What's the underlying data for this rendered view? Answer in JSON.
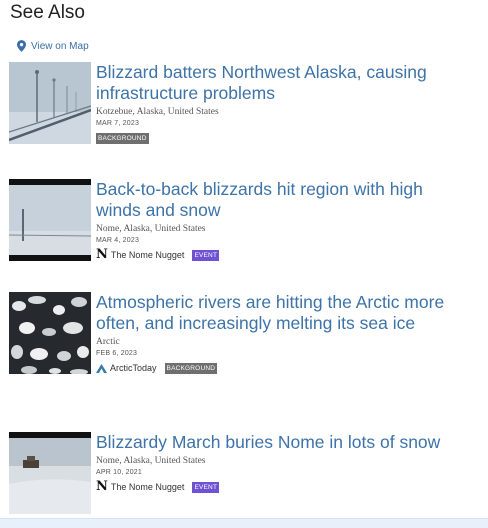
{
  "section": {
    "heading": "See Also"
  },
  "map_link": {
    "label": "View on Map",
    "icon": "map-pin-icon"
  },
  "articles": [
    {
      "title": "Blizzard batters Northwest Alaska, causing infrastructure problems",
      "location": "Kotzebue, Alaska, United States",
      "date": "MAR 7, 2023",
      "publisher": "",
      "tag": "BACKGROUND"
    },
    {
      "title": "Back-to-back blizzards hit region with high winds and snow",
      "location": "Nome, Alaska, United States",
      "date": "MAR 4, 2023",
      "publisher": "The Nome Nugget",
      "publisher_mark": "N",
      "tag": "EVENT"
    },
    {
      "title": "Atmospheric rivers are hitting the Arctic more often, and increasingly melting its sea ice",
      "location": "Arctic",
      "date": "FEB 6, 2023",
      "publisher": "ArcticToday",
      "tag": "BACKGROUND"
    },
    {
      "title": "Blizzardy March buries Nome in lots of snow",
      "location": "Nome, Alaska, United States",
      "date": "APR 10, 2021",
      "publisher": "The Nome Nugget",
      "publisher_mark": "N",
      "tag": "EVENT"
    }
  ],
  "colors": {
    "link": "#3d73a8",
    "background_badge": "#6f6f6f",
    "event_badge": "#6f52d4"
  }
}
